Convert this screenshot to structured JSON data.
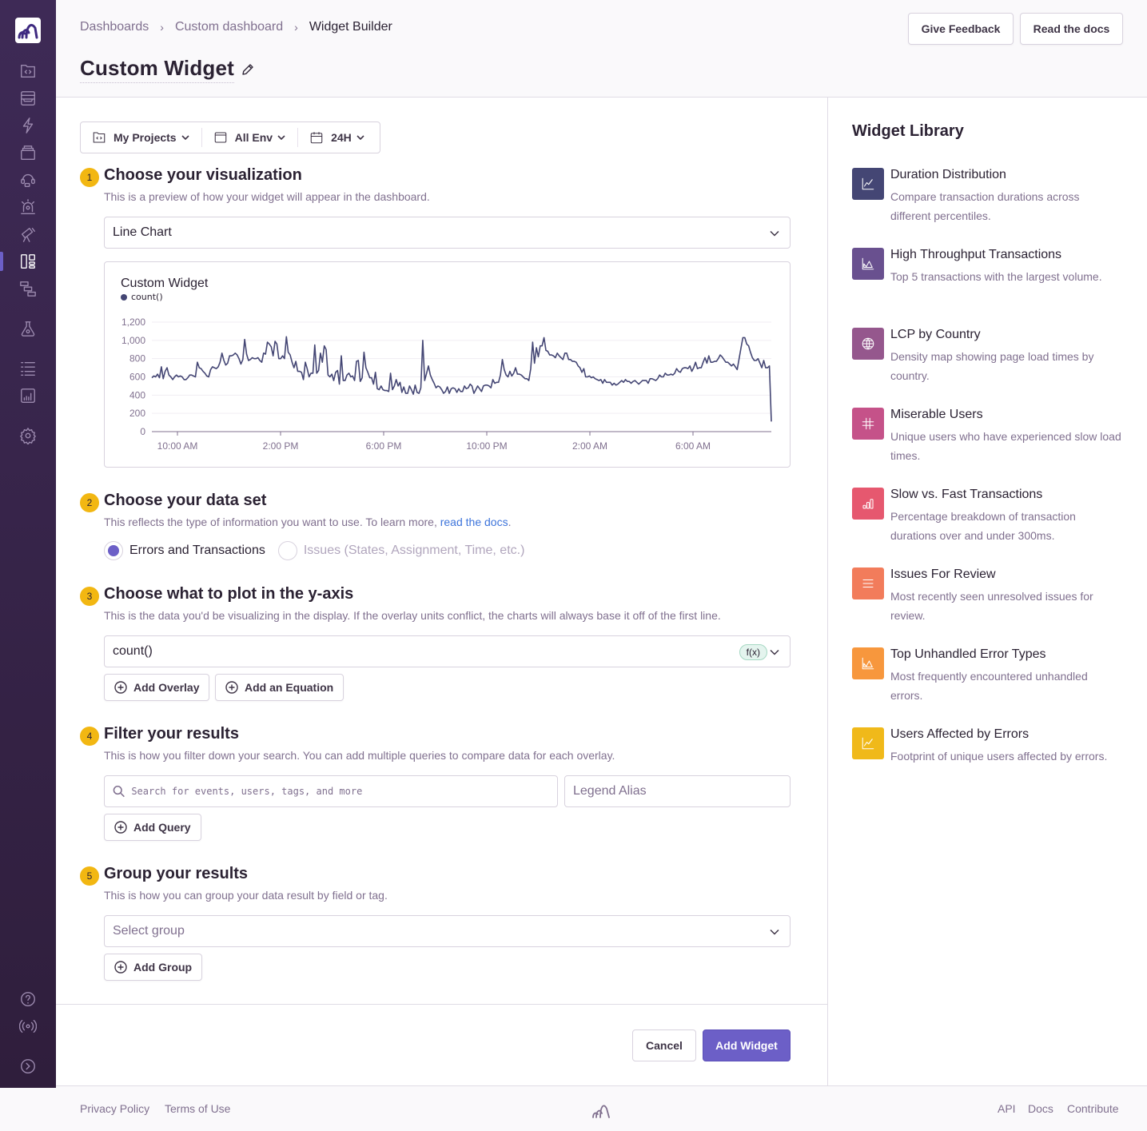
{
  "sidebar": {
    "logo": "sentry-org-logo",
    "items": [
      {
        "name": "projects",
        "icon": "folder-code-icon"
      },
      {
        "name": "issues",
        "icon": "inbox-icon"
      },
      {
        "name": "performance",
        "icon": "lightning-icon"
      },
      {
        "name": "releases",
        "icon": "stack-icon"
      },
      {
        "name": "user-feedback",
        "icon": "headset-icon"
      },
      {
        "name": "alerts",
        "icon": "siren-icon"
      },
      {
        "name": "discover",
        "icon": "telescope-icon"
      },
      {
        "name": "dashboards",
        "icon": "dashboard-icon",
        "active": true
      },
      {
        "name": "monitors",
        "icon": "hierarchy-icon"
      },
      {
        "name": "profiling",
        "icon": "flask-icon"
      },
      {
        "name": "activity",
        "icon": "list-icon"
      },
      {
        "name": "stats",
        "icon": "bar-chart-icon"
      },
      {
        "name": "settings",
        "icon": "gear-icon"
      }
    ],
    "bottom": [
      {
        "name": "help",
        "icon": "question-icon"
      },
      {
        "name": "broadcasts",
        "icon": "broadcast-icon"
      },
      {
        "name": "collapse",
        "icon": "chevron-right-circle-icon"
      }
    ]
  },
  "header": {
    "breadcrumbs": [
      "Dashboards",
      "Custom dashboard",
      "Widget Builder"
    ],
    "title": "Custom Widget",
    "give_feedback": "Give Feedback",
    "read_docs": "Read the docs"
  },
  "filters": {
    "projects": "My Projects",
    "environment": "All Env",
    "period": "24H"
  },
  "steps": [
    {
      "num": "1",
      "title": "Choose your visualization",
      "desc": "This is a preview of how your widget will appear in the dashboard."
    },
    {
      "num": "2",
      "title": "Choose your data set",
      "desc": "This reflects the type of information you want to use. To learn more, ",
      "link": "read the docs",
      "desc_end": "."
    },
    {
      "num": "3",
      "title": "Choose what to plot in the y-axis",
      "desc": "This is the data you'd be visualizing in the display. If the overlay units conflict, the charts will always base it off of the first line."
    },
    {
      "num": "4",
      "title": "Filter your results",
      "desc": "This is how you filter down your search. You can add multiple queries to compare data for each overlay."
    },
    {
      "num": "5",
      "title": "Group your results",
      "desc": "This is how you can group your data result by field or tag."
    }
  ],
  "visualization": {
    "selected": "Line Chart"
  },
  "dataset": {
    "options": [
      {
        "label": "Errors and Transactions",
        "selected": true,
        "disabled": false
      },
      {
        "label": "Issues (States, Assignment, Time, etc.)",
        "selected": false,
        "disabled": true
      }
    ]
  },
  "yaxis": {
    "value": "count()",
    "badge": "f(x)",
    "add_overlay": "Add Overlay",
    "add_equation": "Add an Equation"
  },
  "filter": {
    "search_placeholder": "Search for events, users, tags, and more",
    "alias_placeholder": "Legend Alias",
    "add_query": "Add Query"
  },
  "group": {
    "placeholder": "Select group",
    "add_group": "Add Group"
  },
  "actions": {
    "cancel": "Cancel",
    "add_widget": "Add Widget"
  },
  "library": {
    "title": "Widget Library",
    "items": [
      {
        "title": "Duration Distribution",
        "desc": "Compare transaction durations across different percentiles.",
        "color": "#444674",
        "icon": "line-chart-icon"
      },
      {
        "title": "High Throughput Transactions",
        "desc": "Top 5 transactions with the largest volume.",
        "color": "#69508f",
        "icon": "area-chart-icon"
      },
      {
        "title": "LCP by Country",
        "desc": "Density map showing page load times by country.",
        "color": "#95578d",
        "icon": "globe-icon"
      },
      {
        "title": "Miserable Users",
        "desc": "Unique users who have experienced slow load times.",
        "color": "#c55289",
        "icon": "hash-icon"
      },
      {
        "title": "Slow vs. Fast Transactions",
        "desc": "Percentage breakdown of transaction durations over and under 300ms.",
        "color": "#e6586f",
        "icon": "bar-chart-icon"
      },
      {
        "title": "Issues For Review",
        "desc": "Most recently seen unresolved issues for review.",
        "color": "#f27c5b",
        "icon": "list-icon"
      },
      {
        "title": "Top Unhandled Error Types",
        "desc": "Most frequently encountered unhandled errors.",
        "color": "#f7973d",
        "icon": "area-chart-icon"
      },
      {
        "title": "Users Affected by Errors",
        "desc": "Footprint of unique users affected by errors.",
        "color": "#f0b91a",
        "icon": "line-chart-icon"
      }
    ]
  },
  "footer": {
    "privacy": "Privacy Policy",
    "terms": "Terms of Use",
    "api": "API",
    "docs": "Docs",
    "contribute": "Contribute"
  },
  "chart_data": {
    "type": "line",
    "title": "Custom Widget",
    "legend": [
      "count()"
    ],
    "series": [
      {
        "name": "count()",
        "color": "#444674",
        "values": [
          590,
          610,
          600,
          630,
          590,
          710,
          580,
          660,
          700,
          620,
          600,
          570,
          600,
          620,
          600,
          610,
          600,
          570,
          570,
          590,
          620,
          620,
          610,
          600,
          760,
          700,
          690,
          660,
          640,
          610,
          600,
          680,
          710,
          700,
          690,
          710,
          760,
          860,
          780,
          730,
          750,
          830,
          830,
          840,
          860,
          840,
          800,
          740,
          790,
          1010,
          850,
          780,
          790,
          810,
          800,
          800,
          810,
          780,
          760,
          860,
          850,
          980,
          960,
          930,
          830,
          990,
          960,
          800,
          800,
          830,
          800,
          1040,
          870,
          840,
          760,
          700,
          770,
          660,
          660,
          650,
          570,
          760,
          690,
          600,
          640,
          640,
          950,
          640,
          670,
          860,
          760,
          940,
          900,
          620,
          600,
          630,
          560,
          650,
          670,
          520,
          830,
          560,
          560,
          620,
          640,
          600,
          610,
          560,
          770,
          780,
          550,
          590,
          870,
          700,
          650,
          590,
          590,
          520,
          650,
          470,
          460,
          500,
          460,
          450,
          450,
          440,
          640,
          460,
          500,
          570,
          500,
          540,
          430,
          490,
          420,
          420,
          500,
          460,
          410,
          510,
          430,
          420,
          480,
          1000,
          560,
          640,
          720,
          620,
          570,
          530,
          480,
          500,
          490,
          460,
          420,
          440,
          490,
          420,
          470,
          480,
          470,
          430,
          470,
          440,
          440,
          500,
          470,
          480,
          520,
          500,
          420,
          460,
          500,
          470,
          440,
          500,
          510,
          510,
          500,
          480,
          570,
          530,
          540,
          540,
          620,
          790,
          680,
          620,
          600,
          660,
          610,
          640,
          700,
          630,
          630,
          620,
          600,
          580,
          580,
          560,
          690,
          980,
          750,
          920,
          820,
          940,
          940,
          1030,
          890,
          880,
          840,
          840,
          830,
          810,
          860,
          830,
          810,
          790,
          860,
          860,
          790,
          790,
          770,
          770,
          760,
          720,
          700,
          650,
          690,
          600,
          600,
          610,
          590,
          600,
          580,
          570,
          560,
          570,
          530,
          570,
          540,
          540,
          540,
          510,
          530,
          510,
          520,
          540,
          560,
          540,
          570,
          550,
          550,
          530,
          550,
          560,
          540,
          520,
          540,
          560,
          560,
          560,
          530,
          580,
          580,
          570,
          560,
          580,
          620,
          600,
          600,
          640,
          620,
          620,
          630,
          620,
          640,
          690,
          660,
          650,
          690,
          700,
          700,
          690,
          720,
          660,
          700,
          760,
          690,
          700,
          700,
          760,
          810,
          750,
          830,
          760,
          760,
          770,
          770,
          800,
          840,
          820,
          790,
          760,
          760,
          740,
          720,
          740,
          710,
          680,
          800,
          920,
          1030,
          1030,
          960,
          940,
          870,
          810,
          780,
          780,
          800,
          750,
          700,
          780,
          700,
          700,
          720,
          110
        ]
      }
    ],
    "x_tick_labels": [
      "10:00 AM",
      "2:00 PM",
      "6:00 PM",
      "10:00 PM",
      "2:00 AM",
      "6:00 AM"
    ],
    "y_tick_labels": [
      "0",
      "200",
      "400",
      "600",
      "800",
      "1,000",
      "1,200"
    ],
    "ylim": [
      0,
      1200
    ],
    "grid": true,
    "xlabel": "",
    "ylabel": ""
  }
}
